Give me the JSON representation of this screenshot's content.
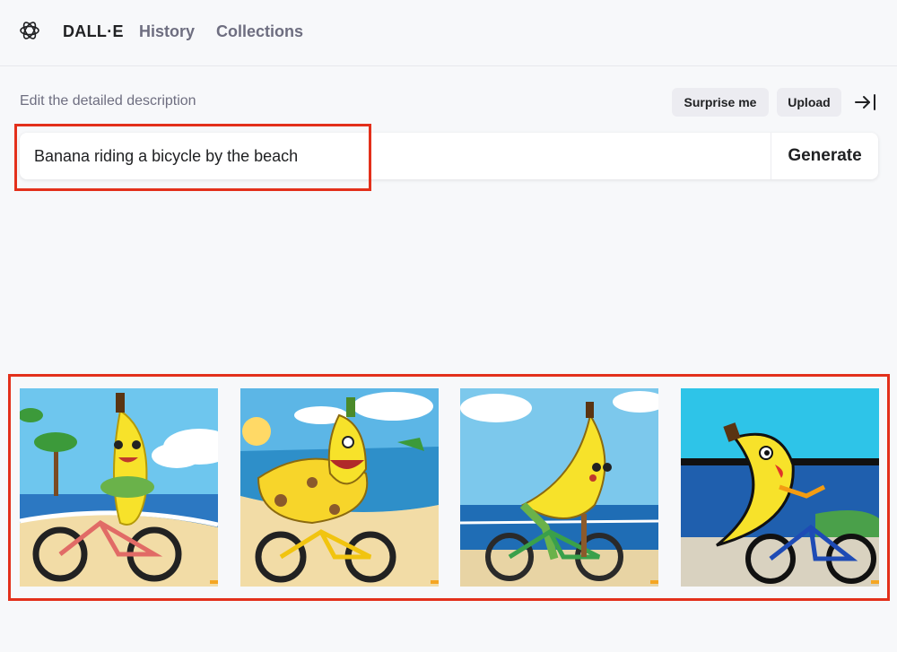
{
  "app": {
    "name": "DALL·E"
  },
  "nav": {
    "items": [
      {
        "label": "History"
      },
      {
        "label": "Collections"
      }
    ]
  },
  "prompt": {
    "label": "Edit the detailed description",
    "value": "Banana riding a bicycle by the beach",
    "generate_label": "Generate"
  },
  "toolbar": {
    "surprise_label": "Surprise me",
    "upload_label": "Upload"
  },
  "results": [
    {
      "name": "result-image-1",
      "style": "banana with scarf on red bicycle, tree and sea behind"
    },
    {
      "name": "result-image-2",
      "style": "spotted banana on yellow bicycle near tropical beach"
    },
    {
      "name": "result-image-3",
      "style": "banana on green bicycle, calm sea and sky"
    },
    {
      "name": "result-image-4",
      "style": "banana on blue bicycle, dark sea horizon"
    }
  ],
  "colors": {
    "highlight": "#e3301b",
    "banana": "#f7e22a",
    "sky": "#6ec6ee",
    "sea": "#2c78c2",
    "sand": "#f2dca6"
  }
}
